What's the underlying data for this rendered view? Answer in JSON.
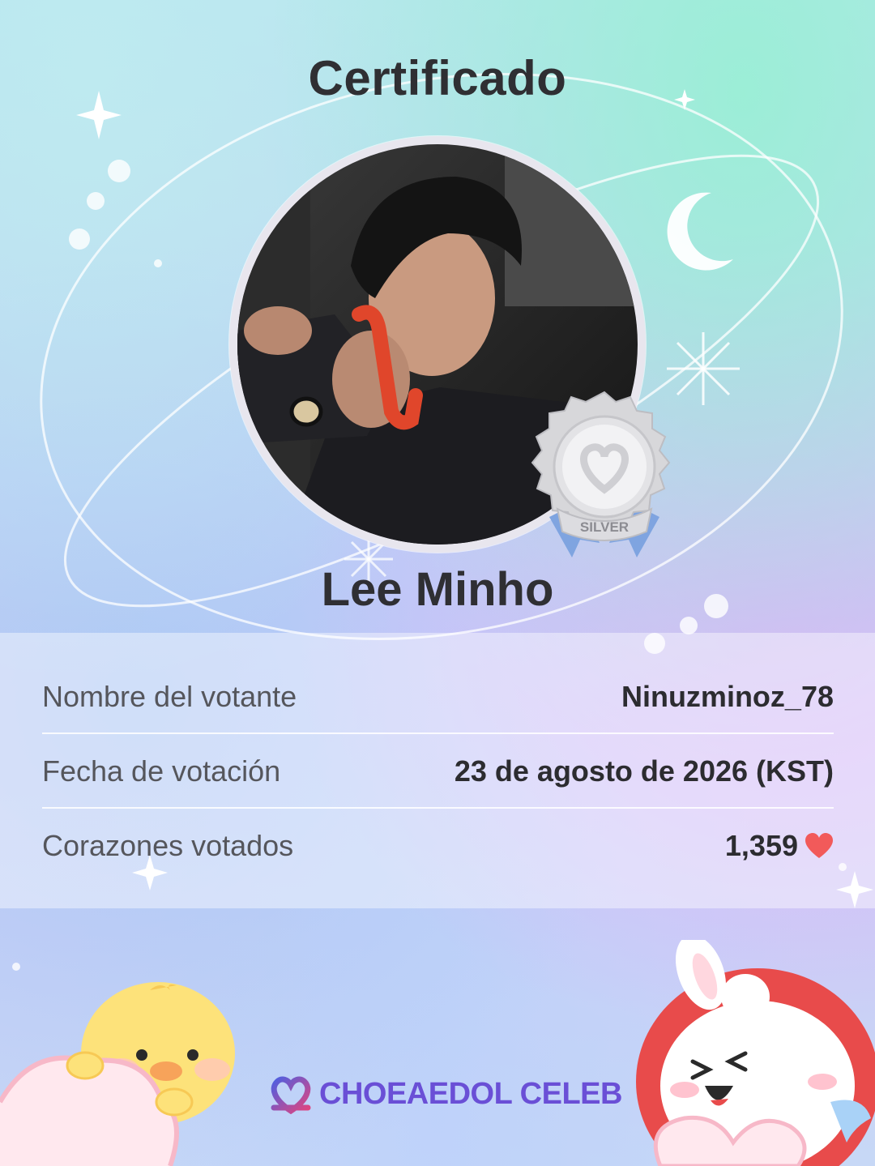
{
  "certificate": {
    "title": "Certificado",
    "celebrity_name": "Lee Minho",
    "badge_label": "SILVER",
    "badge_tier_color": "#c9c9cc"
  },
  "info": [
    {
      "label": "Nombre del votante",
      "value": "Ninuzminoz_78"
    },
    {
      "label": "Fecha de votación",
      "value": "23 de agosto de 2026 (KST)"
    },
    {
      "label": "Corazones votados",
      "value": "1,359",
      "icon": "heart-icon"
    }
  ],
  "brand": {
    "name": "CHOEAEDOL CELEB",
    "logo_icon": "double-heart-logo-icon",
    "color": "#6a4fd6"
  },
  "colors": {
    "heart": "#f25a5a",
    "text_primary": "#2f2f33",
    "text_secondary": "#55565c"
  }
}
